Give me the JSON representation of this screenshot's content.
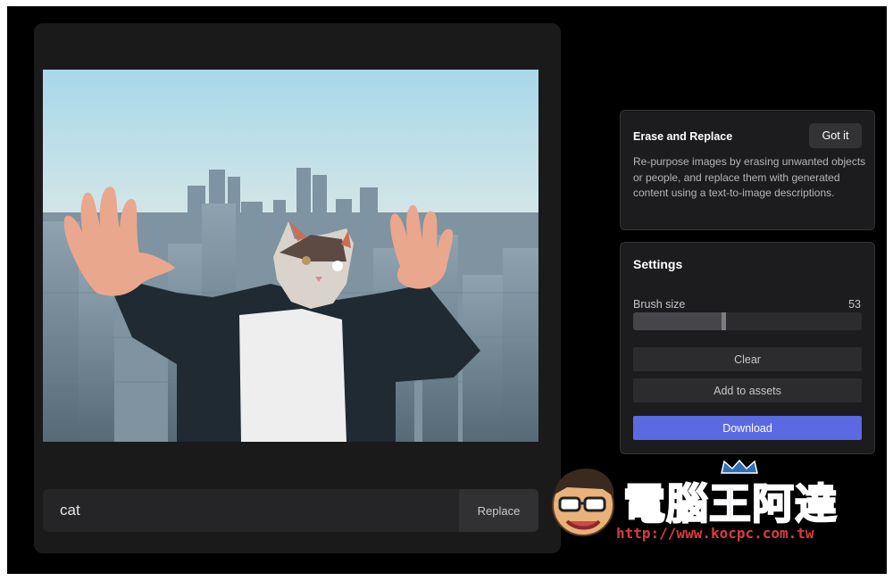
{
  "editor": {
    "prompt": {
      "value": "cat",
      "replace_label": "Replace"
    }
  },
  "info_card": {
    "title": "Erase and Replace",
    "got_it_label": "Got it",
    "description": "Re-purpose images by erasing unwanted objects or people, and replace them with generated content using a text-to-image descriptions."
  },
  "settings": {
    "title": "Settings",
    "brush_label": "Brush size",
    "brush_value": "53",
    "brush_fraction": 0.4,
    "clear_label": "Clear",
    "assets_label": "Add to assets",
    "download_label": "Download"
  },
  "watermark": {
    "name": "電腦王阿達",
    "url": "http://www.kocpc.com.tw"
  },
  "colors": {
    "accent": "#5b6ae0",
    "panel": "#1c1c1e",
    "background": "#000000",
    "watermark_blue": "#2f6fb6",
    "watermark_red": "#d93d3d"
  },
  "icons": [
    "crown-icon",
    "mascot-face-icon"
  ]
}
